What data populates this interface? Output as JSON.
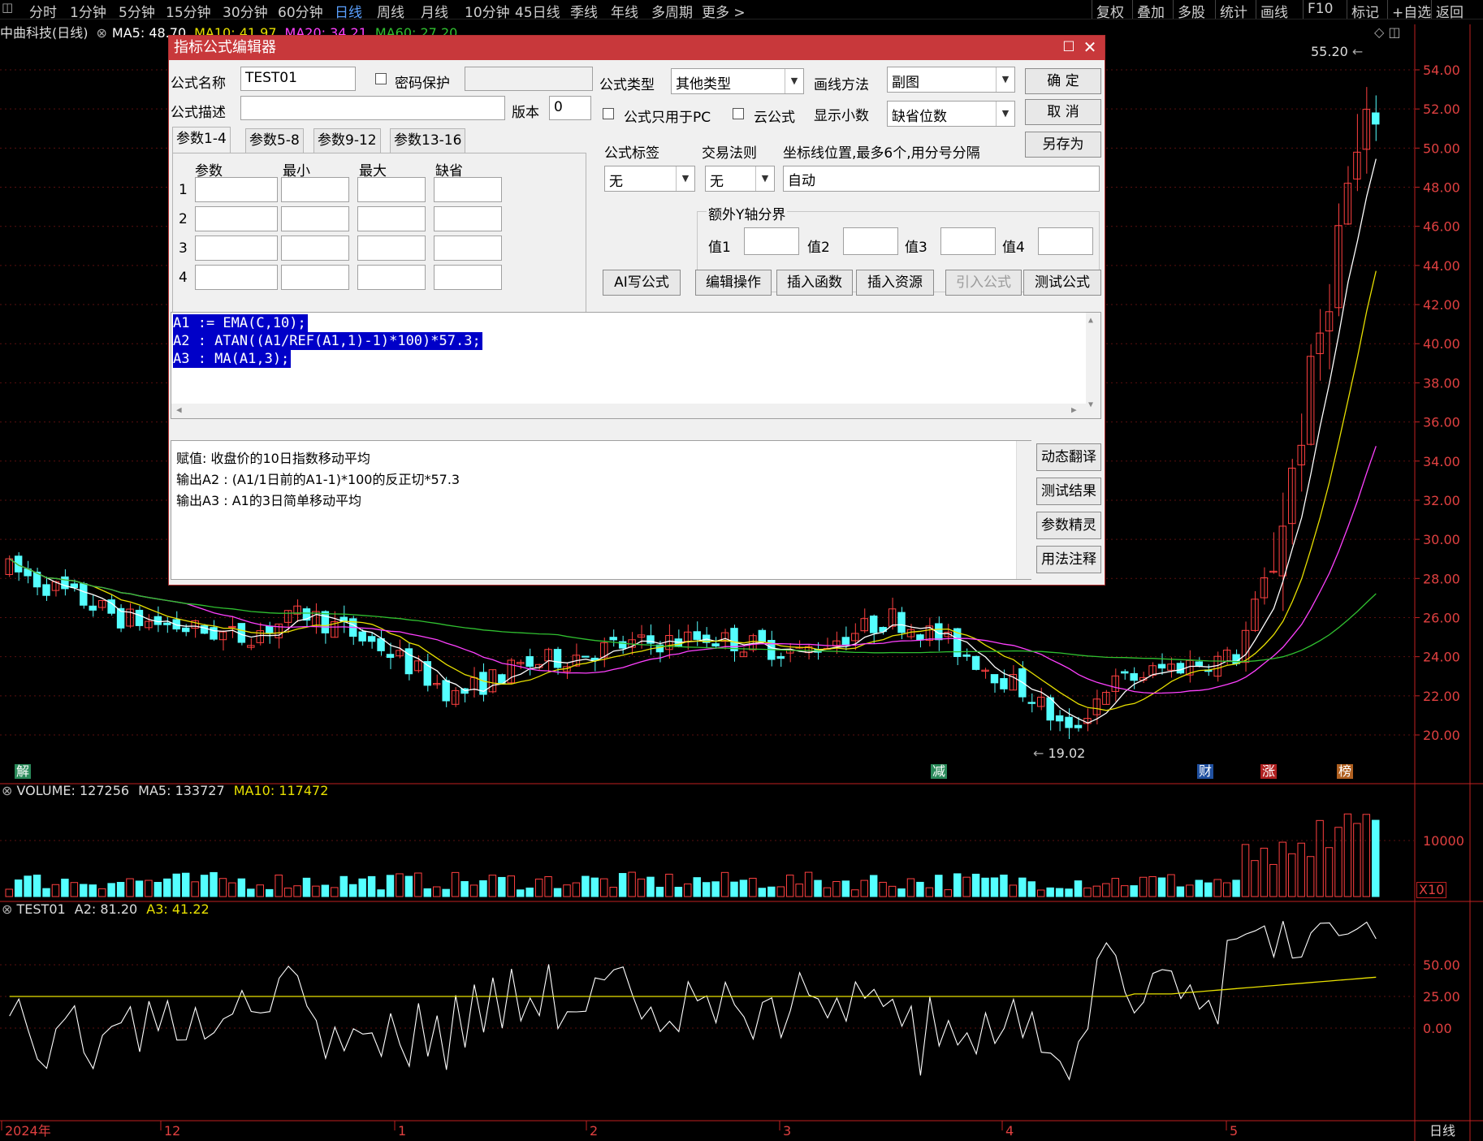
{
  "topbar": {
    "items": [
      "分时",
      "1分钟",
      "5分钟",
      "15分钟",
      "30分钟",
      "60分钟",
      "日线",
      "周线",
      "月线",
      "10分钟",
      "45日线",
      "季线",
      "年线",
      "多周期",
      "更多 >"
    ],
    "active_index": 6,
    "right_items": [
      "复权",
      "叠加",
      "多股",
      "统计",
      "画线",
      "F10",
      "标记",
      "+自选",
      "返回"
    ]
  },
  "infobar": {
    "title": "中曲科技(日线)",
    "ma5": "MA5: 48.70",
    "ma10": "MA10: 41.97",
    "ma20": "MA20: 34.21",
    "ma60": "MA60: 27.20"
  },
  "price_axis": [
    "54.00",
    "52.00",
    "50.00",
    "48.00",
    "46.00",
    "44.00",
    "42.00",
    "40.00",
    "38.00",
    "36.00",
    "34.00",
    "32.00",
    "30.00",
    "28.00",
    "26.00",
    "24.00",
    "22.00",
    "20.00"
  ],
  "high_label": "55.20",
  "low_label": "19.02",
  "markers": [
    {
      "text": "解",
      "color": "#2a8a5a"
    },
    {
      "text": "减",
      "color": "#2a8a5a"
    },
    {
      "text": "财",
      "color": "#2050a0"
    },
    {
      "text": "涨",
      "color": "#b02020"
    },
    {
      "text": "榜",
      "color": "#b06020"
    }
  ],
  "volume_panel": {
    "label": "VOLUME: 127256",
    "ma5": "MA5: 133727",
    "ma10": "MA10: 117472",
    "axis": "10000",
    "unit": "X10"
  },
  "indicator_panel": {
    "label": "TEST01",
    "a2": "A2: 81.20",
    "a3": "A3: 41.22",
    "axis": [
      "50.00",
      "25.00",
      "0.00"
    ]
  },
  "date_axis": [
    "2024年",
    "12",
    "1",
    "2",
    "3",
    "4",
    "5"
  ],
  "date_axis_right": "日线",
  "dialog": {
    "title": "指标公式编辑器",
    "formula_name_label": "公式名称",
    "formula_name": "TEST01",
    "password_label": "密码保护",
    "formula_type_label": "公式类型",
    "formula_type": "其他类型",
    "draw_method_label": "画线方法",
    "draw_method": "副图",
    "ok": "确  定",
    "cancel": "取  消",
    "save_as": "另存为",
    "desc_label": "公式描述",
    "version_label": "版本",
    "version": "0",
    "pc_only_label": "公式只用于PC",
    "cloud_label": "云公式",
    "decimals_label": "显示小数",
    "decimals": "缺省位数",
    "tabs": [
      "参数1-4",
      "参数5-8",
      "参数9-12",
      "参数13-16"
    ],
    "param_headers": [
      "参数",
      "最小",
      "最大",
      "缺省"
    ],
    "param_rows": [
      "1",
      "2",
      "3",
      "4"
    ],
    "tag_label": "公式标签",
    "tag_value": "无",
    "trade_label": "交易法则",
    "trade_value": "无",
    "coord_label": "坐标线位置,最多6个,用分号分隔",
    "coord_value": "自动",
    "extra_y_label": "额外Y轴分界",
    "vals": [
      "值1",
      "值2",
      "值3",
      "值4"
    ],
    "buttons": [
      "AI写公式",
      "编辑操作",
      "插入函数",
      "插入资源",
      "引入公式",
      "测试公式"
    ],
    "code": [
      "A1 := EMA(C,10);",
      "A2 : ATAN((A1/REF(A1,1)-1)*100)*57.3;",
      "A3 : MA(A1,3);"
    ],
    "desc": [
      "赋值: 收盘价的10日指数移动平均",
      "输出A2 : (A1/1日前的A1-1)*100的反正切*57.3",
      "输出A3 : A1的3日简单移动平均"
    ],
    "side_buttons": [
      "动态翻译",
      "测试结果",
      "参数精灵",
      "用法注释"
    ]
  },
  "colors": {
    "up": "#ff4040",
    "down": "#54ffff",
    "ma5": "#ffffff",
    "ma10": "#e8e000",
    "ma20": "#ff40ff",
    "ma60": "#30c030",
    "axis": "#c02020",
    "dialog_title": "#c8383b"
  }
}
